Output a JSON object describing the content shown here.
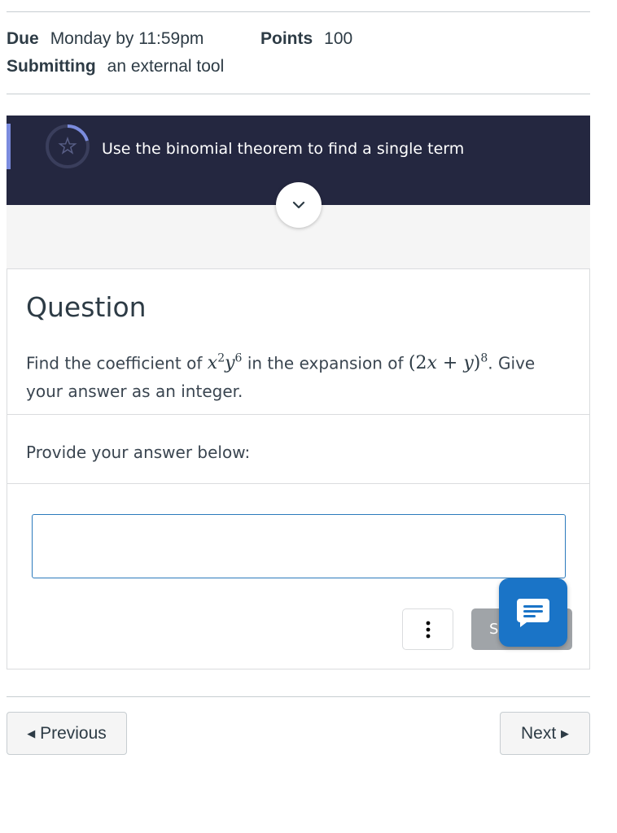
{
  "assignment": {
    "due_label": "Due",
    "due_value": "Monday by 11:59pm",
    "points_label": "Points",
    "points_value": "100",
    "submitting_label": "Submitting",
    "submitting_value": "an external tool"
  },
  "tool": {
    "banner_title": "Use the binomial theorem to find a single term",
    "banner_color": "#242740",
    "accent_color": "#7b8cde"
  },
  "question": {
    "heading": "Question",
    "text_before": "Find the coefficient of",
    "text_middle": "in the expansion of",
    "text_after": ". Give your answer as an integer.",
    "term": {
      "x": "x",
      "x_exp": "2",
      "y": "y",
      "y_exp": "6"
    },
    "expansion": {
      "open": "(2",
      "var1": "x",
      "plus": " + ",
      "var2": "y",
      "close": ")",
      "power": "8"
    },
    "prompt": "Provide your answer below:",
    "answer_value": "",
    "answer_placeholder": ""
  },
  "actions": {
    "more_icon": "vertical-ellipsis-icon",
    "submit_label": "S",
    "chat_icon": "chat-bubble-icon",
    "chat_color": "#1a74c7"
  },
  "nav": {
    "previous_label": "Previous",
    "next_label": "Next"
  }
}
